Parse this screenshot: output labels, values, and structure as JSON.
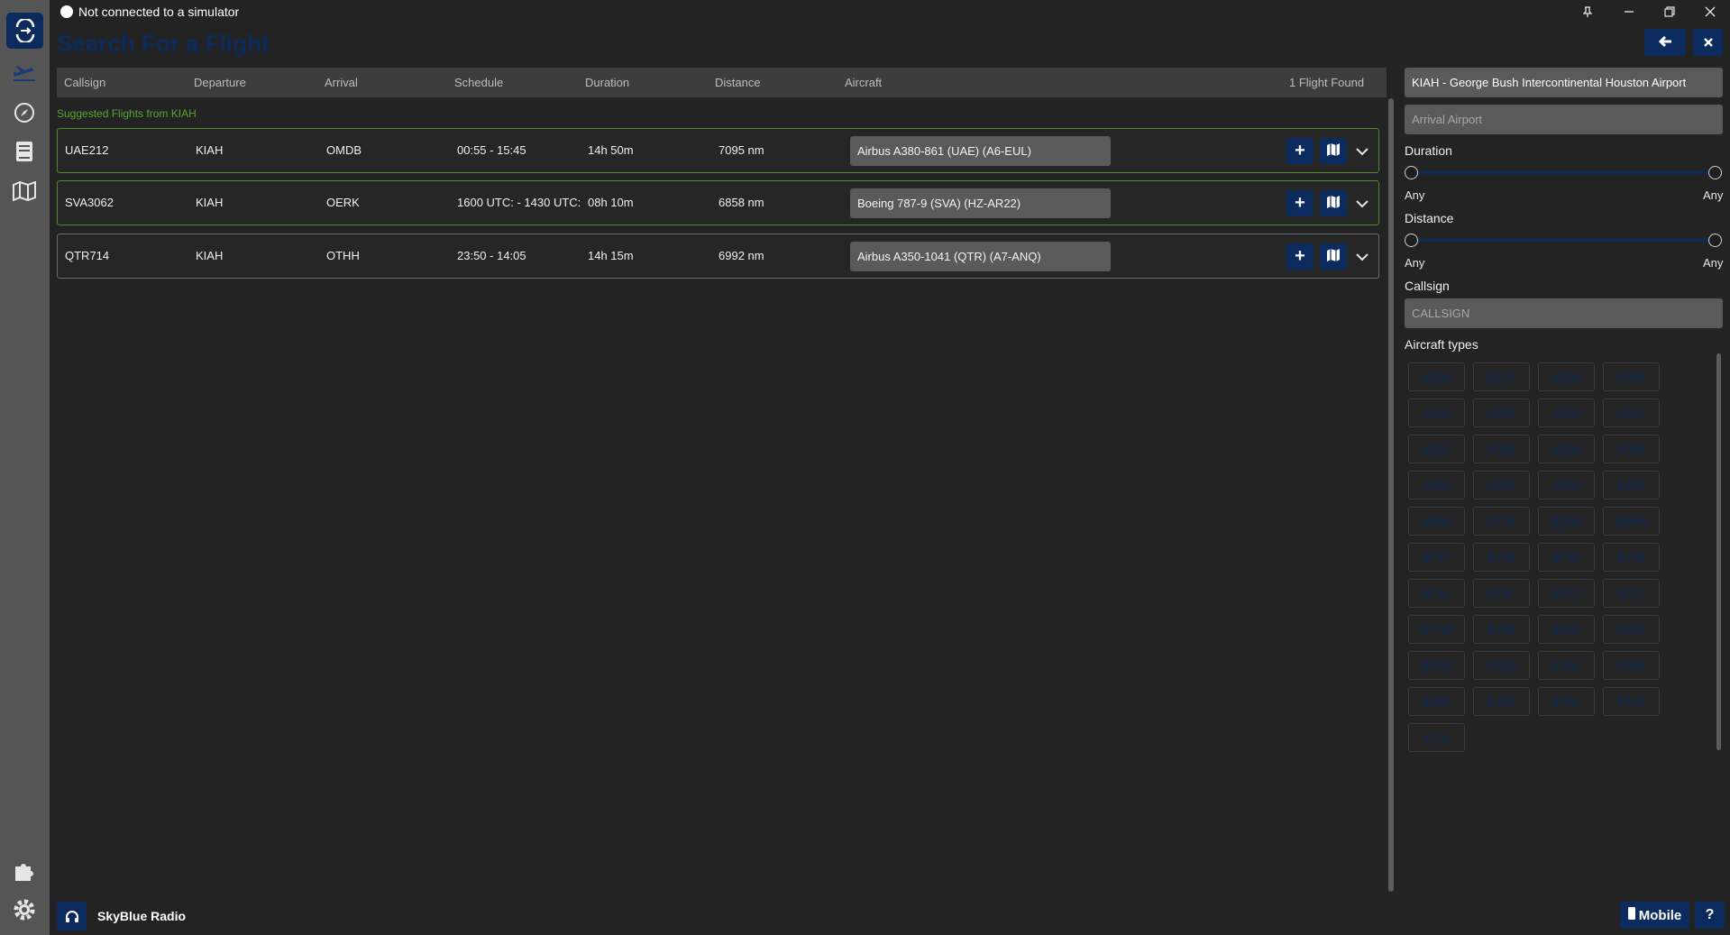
{
  "status": {
    "connection_text": "Not connected to a simulator"
  },
  "page": {
    "title": "Search For a Flight"
  },
  "table": {
    "headers": [
      "Callsign",
      "Departure",
      "Arrival",
      "Schedule",
      "Duration",
      "Distance",
      "Aircraft"
    ],
    "found_count": "1 Flight Found",
    "suggested_label": "Suggested Flights from KIAH",
    "rows": [
      {
        "callsign": "UAE212",
        "departure": "KIAH",
        "arrival": "OMDB",
        "schedule": "00:55 - 15:45",
        "duration": "14h 50m",
        "distance": "7095 nm",
        "aircraft": "Airbus A380-861 (UAE) (A6-EUL)"
      },
      {
        "callsign": "SVA3062",
        "departure": "KIAH",
        "arrival": "OERK",
        "schedule": "1600 UTC: - 1430 UTC:",
        "duration": "08h 10m",
        "distance": "6858 nm",
        "aircraft": "Boeing 787-9 (SVA) (HZ-AR22)"
      },
      {
        "callsign": "QTR714",
        "departure": "KIAH",
        "arrival": "OTHH",
        "schedule": "23:50 - 14:05",
        "duration": "14h 15m",
        "distance": "6992 nm",
        "aircraft": "Airbus A350-1041 (QTR) (A7-ANQ)"
      }
    ]
  },
  "filters": {
    "departure_value": "KIAH - George Bush Intercontinental Houston Airport",
    "arrival_placeholder": "Arrival Airport",
    "duration_label": "Duration",
    "duration_min": "Any",
    "duration_max": "Any",
    "distance_label": "Distance",
    "distance_min": "Any",
    "distance_max": "Any",
    "callsign_label": "Callsign",
    "callsign_placeholder": "CALLSIGN",
    "aircraft_types_label": "Aircraft types",
    "aircraft_types": [
      "A20N",
      "A21N",
      "A306",
      "A30B",
      "A310",
      "A319",
      "A320",
      "A321",
      "A332",
      "A333",
      "A338",
      "A339",
      "A342",
      "A346",
      "A359",
      "A35K",
      "A388",
      "AT76",
      "B38M",
      "B39M",
      "B737",
      "B738",
      "B739",
      "B748",
      "B744",
      "B74F",
      "B772",
      "B77L",
      "B77W",
      "B788",
      "B789",
      "B78X",
      "BCS3",
      "CRJ9",
      "E195",
      "E290",
      "E295",
      "E350",
      "E75L",
      "F100",
      "IL76"
    ]
  },
  "footer": {
    "radio_label": "SkyBlue Radio",
    "mobile_label": "Mobile",
    "help_label": "?"
  },
  "colors": {
    "accent": "#0b2a5e",
    "suggested": "#59a32f",
    "sidebar": "#555555",
    "background": "#232323"
  }
}
